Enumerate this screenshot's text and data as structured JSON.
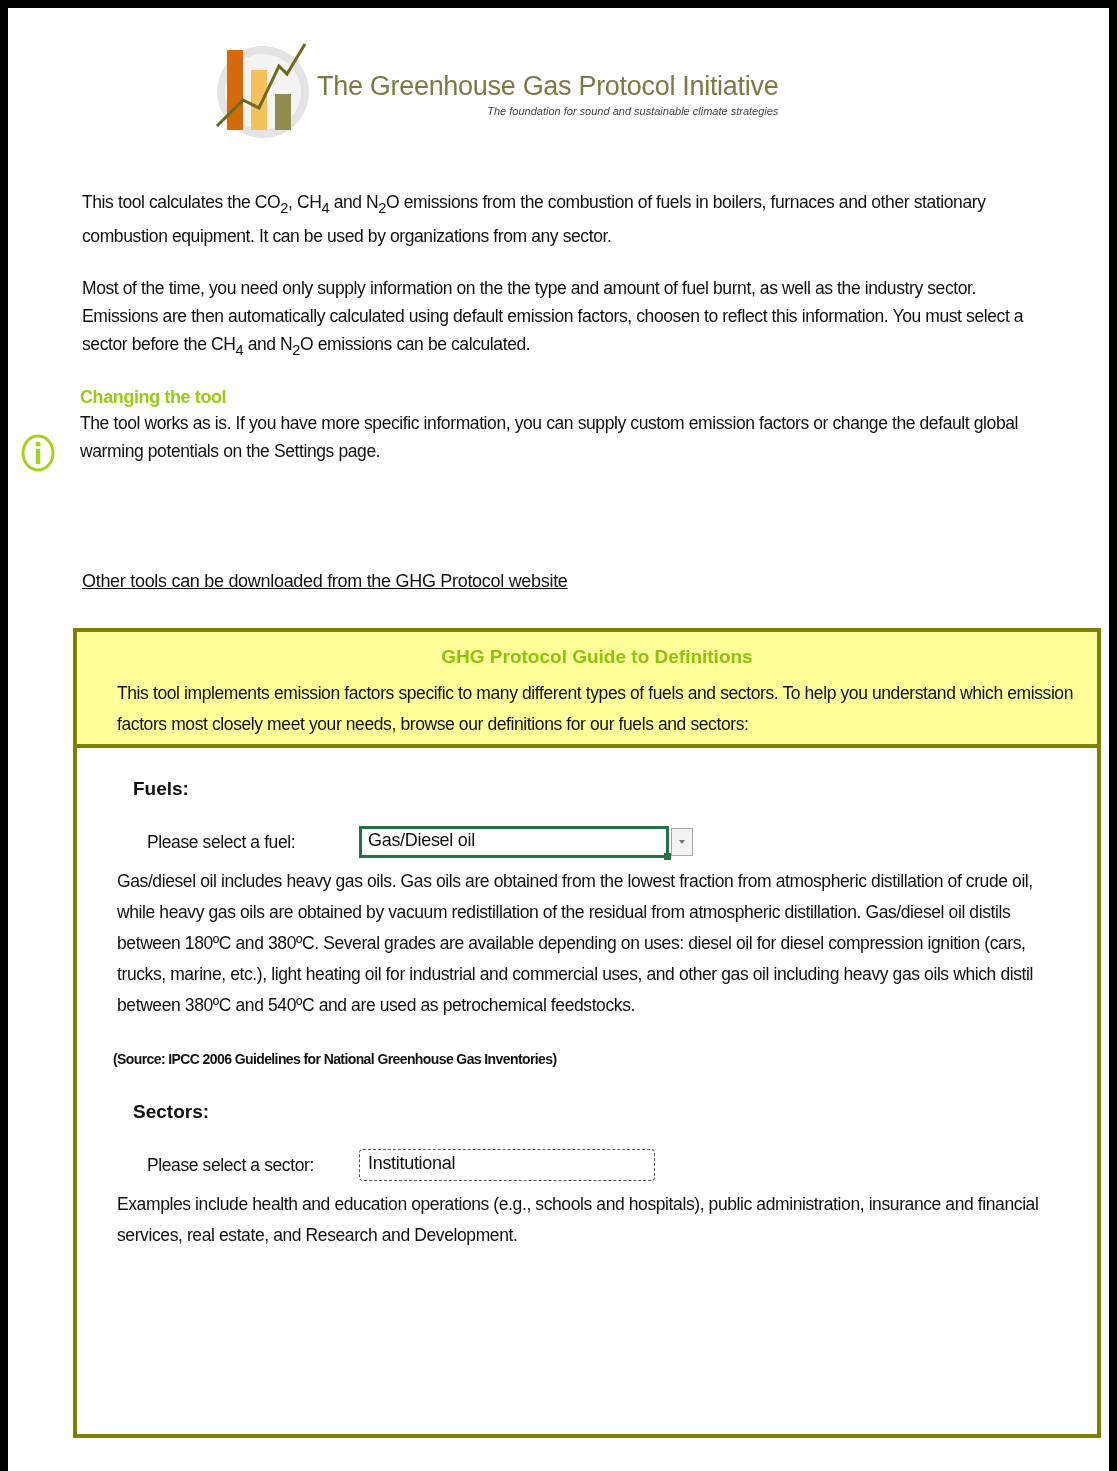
{
  "header": {
    "title": "The Greenhouse Gas Protocol Initiative",
    "tagline": "The foundation for sound and sustainable climate strategies"
  },
  "intro": [
    "This tool calculates the CO$_{2}$, CH$_{4}$ and N$_{2}$O emissions from the combustion of fuels in boilers, furnaces and other stationary combustion equipment. It can be used by organizations from any sector.",
    "Most of the time, you need only supply information on the the type and amount of fuel burnt, as well as the industry sector. Emissions are then automatically calculated using default emission factors, choosen to reflect this information. You must select a sector before the CH$_{4}$ and N$_{2}$O emissions can be calculated."
  ],
  "note": {
    "heading": "Changing the tool",
    "text": "The tool works as is. If you have more specific information, you can supply custom emission factors or change the default global warming potentials on the Settings page."
  },
  "link": "Other tools can be downloaded from the GHG Protocol website",
  "guide": {
    "title": "GHG Protocol Guide to Definitions",
    "text": "This tool implements emission factors specific to many different types of fuels and sectors. To help you understand which emission factors most closely meet your needs, browse our definitions for our fuels and sectors:"
  },
  "sections": [
    {
      "heading": "Fuels:",
      "label": "Please select a fuel:",
      "value": "Gas/Diesel oil",
      "selected": true,
      "description": "Gas/diesel oil includes heavy gas oils. Gas oils are obtained from the lowest fraction from atmospheric distillation of crude oil, while heavy gas oils are obtained by vacuum redistillation of the residual from atmospheric distillation. Gas/diesel oil distils between 180ºC and 380ºC. Several grades are available depending on uses: diesel oil for diesel compression ignition (cars, trucks, marine, etc.), light heating oil for industrial and commercial uses, and other gas oil including heavy gas oils which distil between 380ºC and 540ºC and are used as petrochemical feedstocks.",
      "source": "(Source: IPCC 2006 Guidelines for National Greenhouse Gas Inventories)"
    },
    {
      "heading": "Sectors:",
      "label": "Please select a sector:",
      "value": "Institutional",
      "selected": false,
      "description": "Examples include health and education operations (e.g., schools and hospitals), public administration, insurance and financial services, real estate, and Research and Development."
    }
  ]
}
